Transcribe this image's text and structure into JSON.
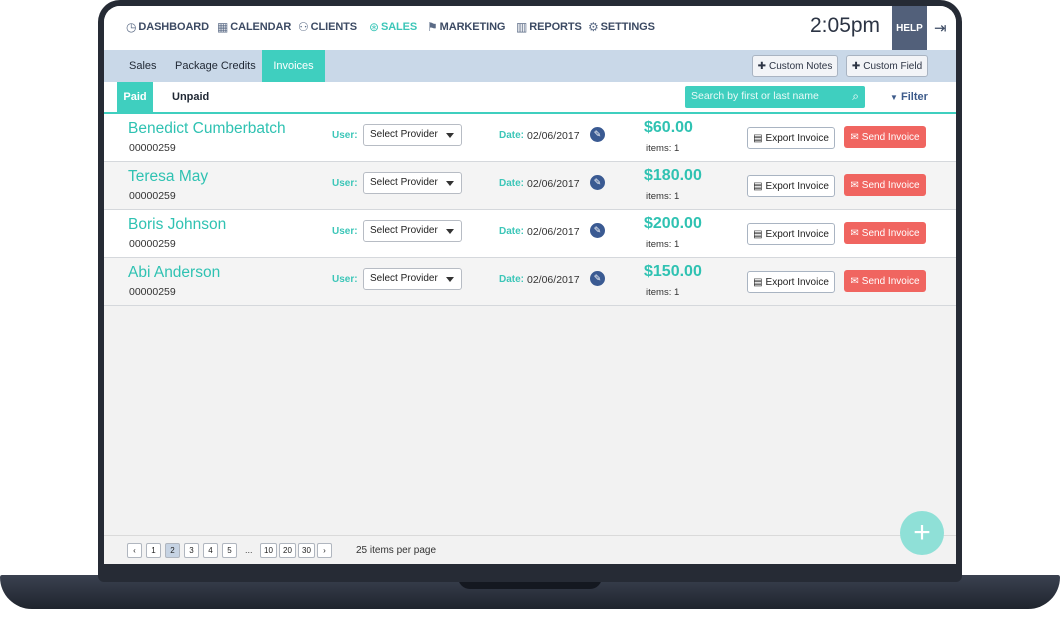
{
  "nav": [
    {
      "label": "DASHBOARD",
      "icon": "◷"
    },
    {
      "label": "CALENDAR",
      "icon": "▦"
    },
    {
      "label": "CLIENTS",
      "icon": "⚇"
    },
    {
      "label": "SALES",
      "icon": "⊛"
    },
    {
      "label": "MARKETING",
      "icon": "⚑"
    },
    {
      "label": "REPORTS",
      "icon": "▥"
    },
    {
      "label": "SETTINGS",
      "icon": "⚙"
    }
  ],
  "clock": "2:05pm",
  "help": "HELP",
  "logout_icon": "⇥",
  "subtabs": [
    "Sales",
    "Package Credits",
    "Invoices"
  ],
  "custom_notes": "Custom Notes",
  "custom_field": "Custom Field",
  "plus": "✚",
  "status_tabs": [
    "Paid",
    "Unpaid"
  ],
  "search_placeholder": "Search by first or last name",
  "search_icon": "⌕",
  "filter": "Filter",
  "filter_icon": "▼",
  "user_label": "User:",
  "date_label": "Date:",
  "select_placeholder": "Select Provider",
  "export_label": "Export Invoice",
  "send_label": "Send Invoice",
  "export_icon": "▤",
  "send_icon": "✉",
  "pencil_icon": "✎",
  "invoices": [
    {
      "name": "Benedict Cumberbatch",
      "id": "00000259",
      "date": "02/06/2017",
      "amount": "$60.00",
      "items": "items: 1"
    },
    {
      "name": "Teresa May",
      "id": "00000259",
      "date": "02/06/2017",
      "amount": "$180.00",
      "items": "items: 1"
    },
    {
      "name": "Boris Johnson",
      "id": "00000259",
      "date": "02/06/2017",
      "amount": "$200.00",
      "items": "items: 1"
    },
    {
      "name": "Abi Anderson",
      "id": "00000259",
      "date": "02/06/2017",
      "amount": "$150.00",
      "items": "items: 1"
    }
  ],
  "pager": {
    "prev": "‹",
    "pages": [
      "1",
      "2",
      "3",
      "4",
      "5"
    ],
    "current": "2",
    "ellipsis": "...",
    "tail": [
      "10",
      "20",
      "30"
    ],
    "next": "›",
    "per_page": "25 items per page"
  },
  "fab_icon": "+"
}
